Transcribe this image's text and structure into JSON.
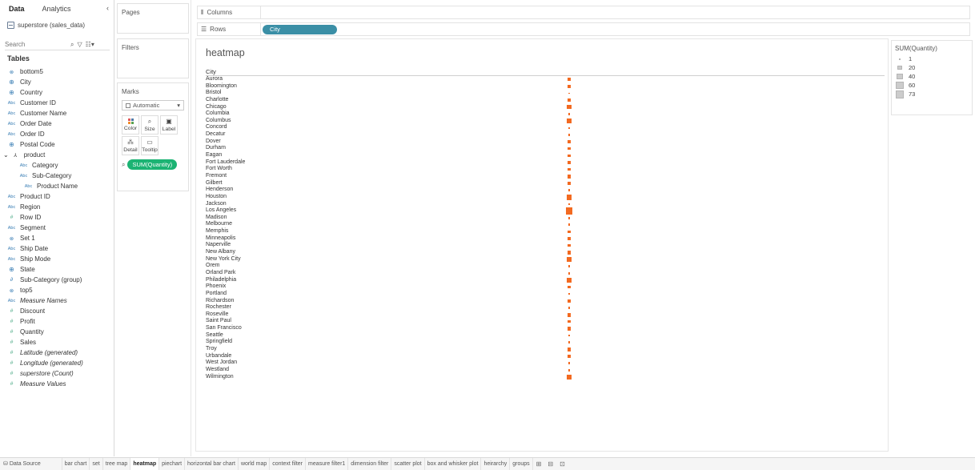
{
  "data_pane": {
    "tabs": [
      "Data",
      "Analytics"
    ],
    "collapse_icon": "‹",
    "datasource": "superstore (sales_data)",
    "search_placeholder": "Search",
    "tables_heading": "Tables",
    "fields": [
      {
        "label": "bottom5",
        "icon": "set-icon",
        "kind": "set"
      },
      {
        "label": "City",
        "icon": "globe-icon",
        "kind": "geo"
      },
      {
        "label": "Country",
        "icon": "globe-icon",
        "kind": "geo"
      },
      {
        "label": "Customer ID",
        "icon": "abc-icon",
        "kind": "str"
      },
      {
        "label": "Customer Name",
        "icon": "abc-icon",
        "kind": "str"
      },
      {
        "label": "Order Date",
        "icon": "abc-icon",
        "kind": "str"
      },
      {
        "label": "Order ID",
        "icon": "abc-icon",
        "kind": "str"
      },
      {
        "label": "Postal Code",
        "icon": "globe-icon",
        "kind": "geo"
      },
      {
        "label": "product",
        "icon": "hierarchy-icon",
        "kind": "hier"
      },
      {
        "label": "Category",
        "icon": "abc-icon",
        "kind": "str",
        "indent": 2
      },
      {
        "label": "Sub-Category",
        "icon": "abc-icon",
        "kind": "str",
        "indent": 2
      },
      {
        "label": "Product Name",
        "icon": "abc-icon",
        "kind": "str",
        "indent": 3
      },
      {
        "label": "Product ID",
        "icon": "abc-icon",
        "kind": "str"
      },
      {
        "label": "Region",
        "icon": "abc-icon",
        "kind": "str"
      },
      {
        "label": "Row ID",
        "icon": "number-icon",
        "kind": "num"
      },
      {
        "label": "Segment",
        "icon": "abc-icon",
        "kind": "str"
      },
      {
        "label": "Set 1",
        "icon": "set-icon",
        "kind": "set"
      },
      {
        "label": "Ship Date",
        "icon": "abc-icon",
        "kind": "str"
      },
      {
        "label": "Ship Mode",
        "icon": "abc-icon",
        "kind": "str"
      },
      {
        "label": "State",
        "icon": "globe-icon",
        "kind": "geo"
      },
      {
        "label": "Sub-Category (group)",
        "icon": "paperclip-icon",
        "kind": "grp"
      },
      {
        "label": "top5",
        "icon": "set-icon",
        "kind": "set"
      },
      {
        "label": "Measure Names",
        "icon": "abc-icon",
        "kind": "str",
        "italic": true
      },
      {
        "label": "Discount",
        "icon": "number-icon",
        "kind": "num",
        "measure": true
      },
      {
        "label": "Profit",
        "icon": "number-icon",
        "kind": "num",
        "measure": true
      },
      {
        "label": "Quantity",
        "icon": "number-icon",
        "kind": "num",
        "measure": true
      },
      {
        "label": "Sales",
        "icon": "number-icon",
        "kind": "num",
        "measure": true
      },
      {
        "label": "Latitude (generated)",
        "icon": "globe-icon",
        "kind": "num",
        "measure": true,
        "italic": true
      },
      {
        "label": "Longitude (generated)",
        "icon": "globe-icon",
        "kind": "num",
        "measure": true,
        "italic": true
      },
      {
        "label": "superstore (Count)",
        "icon": "number-icon",
        "kind": "num",
        "measure": true,
        "italic": true
      },
      {
        "label": "Measure Values",
        "icon": "number-icon",
        "kind": "num",
        "measure": true,
        "italic": true
      }
    ]
  },
  "cards": {
    "pages": "Pages",
    "filters": "Filters",
    "marks": "Marks",
    "mark_type": "Automatic",
    "mark_buttons": [
      "Color",
      "Size",
      "Label",
      "Detail",
      "Tooltip"
    ],
    "size_pill": "SUM(Quantity)"
  },
  "shelves": {
    "columns_label": "Columns",
    "rows_label": "Rows",
    "rows_pill": "City"
  },
  "view": {
    "title": "heatmap",
    "row_header": "City"
  },
  "legend": {
    "title": "SUM(Quantity)",
    "entries": [
      "1",
      "20",
      "40",
      "60",
      "73"
    ]
  },
  "bottom_tabs": {
    "data_source": "Data Source",
    "sheets": [
      "bar chart",
      "set",
      "tree map",
      "heatmap",
      "piechart",
      "horizontal bar chart",
      "world map",
      "context filter",
      "measure filter1",
      "dimension filter",
      "scatter plot",
      "box and whisker plot",
      "heirarchy",
      "groups"
    ],
    "active": "heatmap",
    "new_icons": [
      "new-worksheet-icon",
      "new-dashboard-icon",
      "new-story-icon"
    ]
  },
  "colors": {
    "mark": "#f36a21",
    "rows_pill": "#3b8fa6",
    "size_pill": "#1bb373"
  },
  "chart_data": {
    "type": "heatmap",
    "title": "heatmap",
    "row_dimension": "City",
    "size_measure": "SUM(Quantity)",
    "size_range": [
      1,
      73
    ],
    "categories": [
      "Aurora",
      "Bloomington",
      "Bristol",
      "Charlotte",
      "Chicago",
      "Columbia",
      "Columbus",
      "Concord",
      "Decatur",
      "Dover",
      "Durham",
      "Eagan",
      "Fort Lauderdale",
      "Fort Worth",
      "Fremont",
      "Gilbert",
      "Henderson",
      "Houston",
      "Jackson",
      "Los Angeles",
      "Madison",
      "Melbourne",
      "Memphis",
      "Minneapolis",
      "Naperville",
      "New Albany",
      "New York City",
      "Orem",
      "Orland Park",
      "Philadelphia",
      "Phoenix",
      "Portland",
      "Richardson",
      "Rochester",
      "Roseville",
      "Saint Paul",
      "San Francisco",
      "Seattle",
      "Springfield",
      "Troy",
      "Urbandale",
      "West Jordan",
      "Westland",
      "Wilmington"
    ],
    "values": [
      14,
      14,
      3,
      17,
      27,
      6,
      40,
      6,
      9,
      12,
      11,
      11,
      11,
      11,
      20,
      17,
      9,
      45,
      6,
      73,
      9,
      8,
      11,
      11,
      11,
      23,
      28,
      8,
      8,
      30,
      14,
      2,
      17,
      9,
      25,
      11,
      22,
      5,
      6,
      25,
      11,
      8,
      8,
      32
    ]
  }
}
